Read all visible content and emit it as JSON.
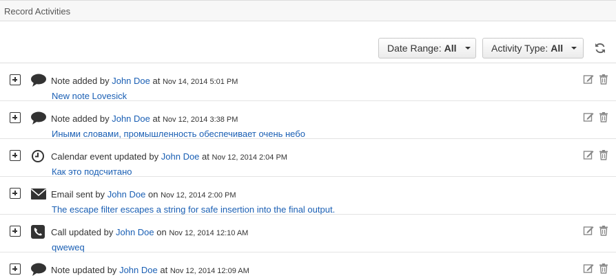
{
  "panel": {
    "title": "Record Activities"
  },
  "filters": {
    "date_range": {
      "label": "Date Range:",
      "value": "All"
    },
    "activity_type": {
      "label": "Activity Type:",
      "value": "All"
    }
  },
  "activities": [
    {
      "icon": "comment-icon",
      "action": "Note added",
      "by": "by",
      "user": "John Doe",
      "prep": "at",
      "time": "Nov 14, 2014 5:01 PM",
      "subject": "New note Lovesick",
      "editable": true
    },
    {
      "icon": "comment-icon",
      "action": "Note added",
      "by": "by",
      "user": "John Doe",
      "prep": "at",
      "time": "Nov 12, 2014 3:38 PM",
      "subject": "Иными словами, промышленность обеспечивает очень небо",
      "editable": true
    },
    {
      "icon": "clock-icon",
      "action": "Calendar event updated",
      "by": "by",
      "user": "John Doe",
      "prep": "at",
      "time": "Nov 12, 2014 2:04 PM",
      "subject": "Как это подсчитано",
      "editable": true
    },
    {
      "icon": "envelope-icon",
      "action": "Email sent",
      "by": "by",
      "user": "John Doe",
      "prep": "on",
      "time": "Nov 12, 2014 2:00 PM",
      "subject": "The escape filter escapes a string for safe insertion into the final output.",
      "editable": false
    },
    {
      "icon": "phone-icon",
      "action": "Call updated",
      "by": "by",
      "user": "John Doe",
      "prep": "on",
      "time": "Nov 12, 2014 12:10 AM",
      "subject": "qweweq",
      "editable": true
    },
    {
      "icon": "comment-icon",
      "action": "Note updated",
      "by": "by",
      "user": "John Doe",
      "prep": "at",
      "time": "Nov 12, 2014 12:09 AM",
      "subject": "",
      "editable": true
    }
  ]
}
